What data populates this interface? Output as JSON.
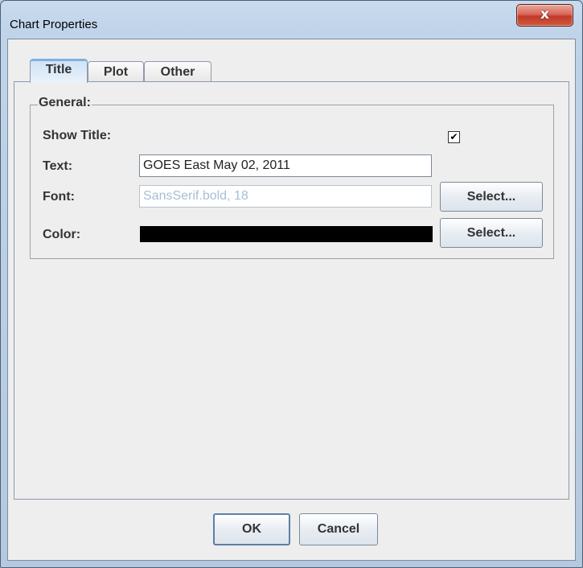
{
  "window": {
    "title": "Chart Properties",
    "close_glyph": "x"
  },
  "tabs": [
    {
      "label": "Title",
      "selected": true
    },
    {
      "label": "Plot",
      "selected": false
    },
    {
      "label": "Other",
      "selected": false
    }
  ],
  "general": {
    "group_title": "General:",
    "show_title_label": "Show Title:",
    "show_title_checked": true,
    "checkbox_glyph": "✔",
    "text_label": "Text:",
    "text_value": "GOES East May 02, 2011",
    "font_label": "Font:",
    "font_value": "SansSerif.bold, 18",
    "font_select": "Select...",
    "color_label": "Color:",
    "color_value": "#000000",
    "color_select": "Select..."
  },
  "footer": {
    "ok_label": "OK",
    "cancel_label": "Cancel"
  }
}
